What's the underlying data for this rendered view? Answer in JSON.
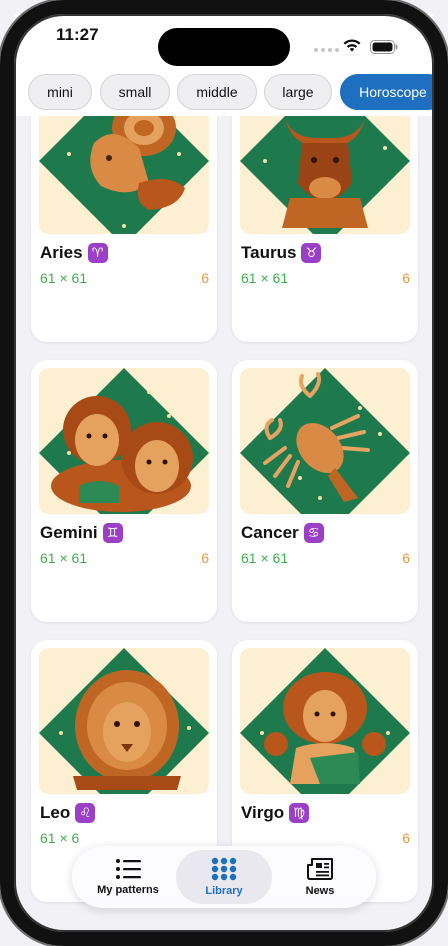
{
  "status_bar": {
    "time": "11:27"
  },
  "filters": [
    {
      "label": "mini"
    },
    {
      "label": "small"
    },
    {
      "label": "middle"
    },
    {
      "label": "large"
    },
    {
      "label": "Horoscope",
      "active": true
    }
  ],
  "cards": [
    {
      "name": "Aries",
      "symbol": "♈",
      "dims": "61 × 61",
      "count": "6"
    },
    {
      "name": "Taurus",
      "symbol": "♉",
      "dims": "61 × 61",
      "count": "6"
    },
    {
      "name": "Gemini",
      "symbol": "♊",
      "dims": "61 × 61",
      "count": "6"
    },
    {
      "name": "Cancer",
      "symbol": "♋",
      "dims": "61 × 61",
      "count": "6"
    },
    {
      "name": "Leo",
      "symbol": "♌",
      "dims": "61 × 6",
      "count": ""
    },
    {
      "name": "Virgo",
      "symbol": "♍",
      "dims": "",
      "count": "6"
    }
  ],
  "tab_bar": {
    "tabs": [
      {
        "label": "My patterns",
        "icon": "list-icon"
      },
      {
        "label": "Library",
        "icon": "grid-dots-icon",
        "active": true
      },
      {
        "label": "News",
        "icon": "newspaper-icon"
      }
    ]
  },
  "colors": {
    "accent": "#1f6fc0",
    "diamond_green": "#1e7a4c",
    "thumb_bg": "#fdefd1",
    "figure_brown": "#b8561c",
    "dims_green": "#3fae4d",
    "count_orange": "#e39a3c",
    "zodiac_purple": "#9b3fc6"
  }
}
